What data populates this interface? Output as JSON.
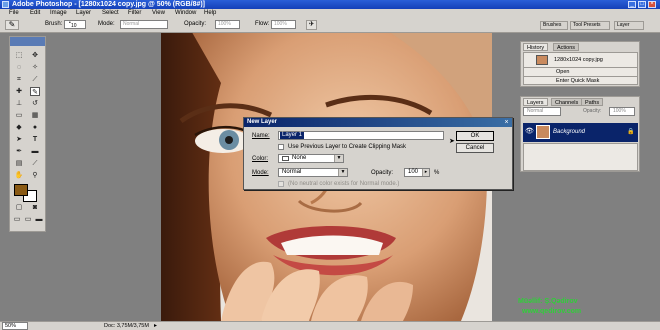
{
  "window": {
    "title": "Adobe Photoshop - [1280x1024 copy.jpg @ 50% (RGB/8#)]"
  },
  "menu": [
    "File",
    "Edit",
    "Image",
    "Layer",
    "Select",
    "Filter",
    "View",
    "Window",
    "Help"
  ],
  "options": {
    "brush_label": "Brush:",
    "brush_size": "10",
    "mode_label": "Mode:",
    "mode_value": "Normal",
    "opacity_label": "Opacity:",
    "opacity_value": "100%",
    "flow_label": "Flow:",
    "flow_value": "100%",
    "tabs": [
      "Brushes",
      "Tool Presets",
      "Layer"
    ]
  },
  "history": {
    "tabs": [
      "History",
      "Actions"
    ],
    "snapshot_name": "1280x1024 copy.jpg",
    "items": [
      "Open",
      "Enter Quick Mask"
    ]
  },
  "layers": {
    "tabs": [
      "Layers",
      "Channels",
      "Paths"
    ],
    "blend_mode": "Normal",
    "opacity_label": "Opacity:",
    "opacity_value": "100%",
    "layer_name": "Background"
  },
  "dialog": {
    "title": "New Layer",
    "name_label": "Name:",
    "name_value": "Layer 1",
    "use_previous_label": "Use Previous Layer to Create Clipping Mask",
    "color_label": "Color:",
    "color_value": "None",
    "mode_label": "Mode:",
    "mode_value": "Normal",
    "opacity_label": "Opacity:",
    "opacity_value": "100",
    "opacity_unit": "%",
    "neutral_label": "(No neutral color exists for Normal mode.)",
    "ok_label": "OK",
    "cancel_label": "Cancel"
  },
  "watermark": {
    "line1": "Müəllif: Ş.Qədirov",
    "line2": "www.qedirov.com"
  },
  "status": {
    "zoom": "50%",
    "doc": "Doc: 3,75M/3,75M"
  },
  "colors": {
    "foreground": "#8a5a14",
    "background": "#ffffff",
    "selection_blue": "#0a246a"
  }
}
